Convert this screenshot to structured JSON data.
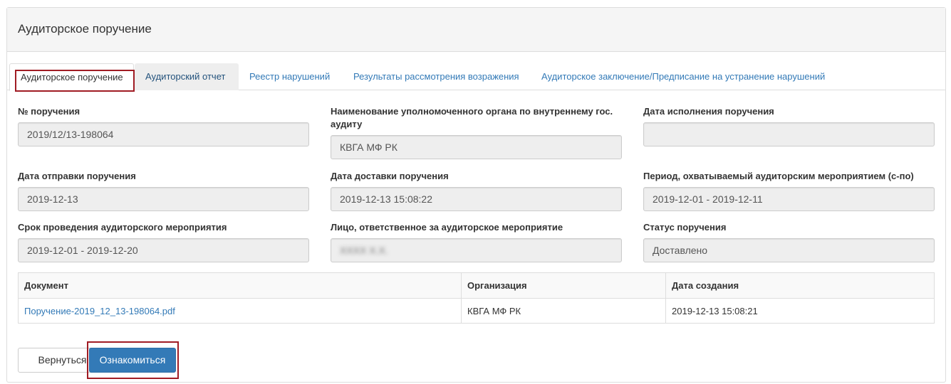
{
  "panel": {
    "title": "Аудиторское поручение"
  },
  "tabs": [
    {
      "label": "Аудиторское поручение"
    },
    {
      "label": "Аудиторский отчет"
    },
    {
      "label": "Реестр нарушений"
    },
    {
      "label": "Результаты рассмотрения возражения"
    },
    {
      "label": "Аудиторское заключение/Предписание на устранение нарушений"
    }
  ],
  "fields": {
    "order_number": {
      "label": "№ поручения",
      "value": "2019/12/13-198064"
    },
    "authority": {
      "label": "Наименование уполномоченного органа по внутреннему гос. аудиту",
      "value": "КВГА МФ РК"
    },
    "execution_date": {
      "label": "Дата исполнения поручения",
      "value": ""
    },
    "send_date": {
      "label": "Дата отправки поручения",
      "value": "2019-12-13"
    },
    "delivery_date": {
      "label": "Дата доставки поручения",
      "value": "2019-12-13 15:08:22"
    },
    "period": {
      "label": "Период, охватываемый аудиторским мероприятием (с-по)",
      "value": "2019-12-01 - 2019-12-11"
    },
    "term": {
      "label": "Срок проведения аудиторского мероприятия",
      "value": "2019-12-01 - 2019-12-20"
    },
    "responsible": {
      "label": "Лицо, ответственное за аудиторское мероприятие",
      "value": "ХХХХ Х.Х."
    },
    "status": {
      "label": "Статус поручения",
      "value": "Доставлено"
    }
  },
  "documents_table": {
    "columns": [
      "Документ",
      "Организация",
      "Дата создания"
    ],
    "rows": [
      {
        "document": "Поручение-2019_12_13-198064.pdf",
        "organization": "КВГА МФ РК",
        "created": "2019-12-13 15:08:21"
      }
    ]
  },
  "buttons": {
    "back": "Вернуться",
    "acknowledge": "Ознакомиться"
  },
  "colors": {
    "primary": "#337ab7",
    "highlight": "#a01c24",
    "link": "#337ab7"
  }
}
